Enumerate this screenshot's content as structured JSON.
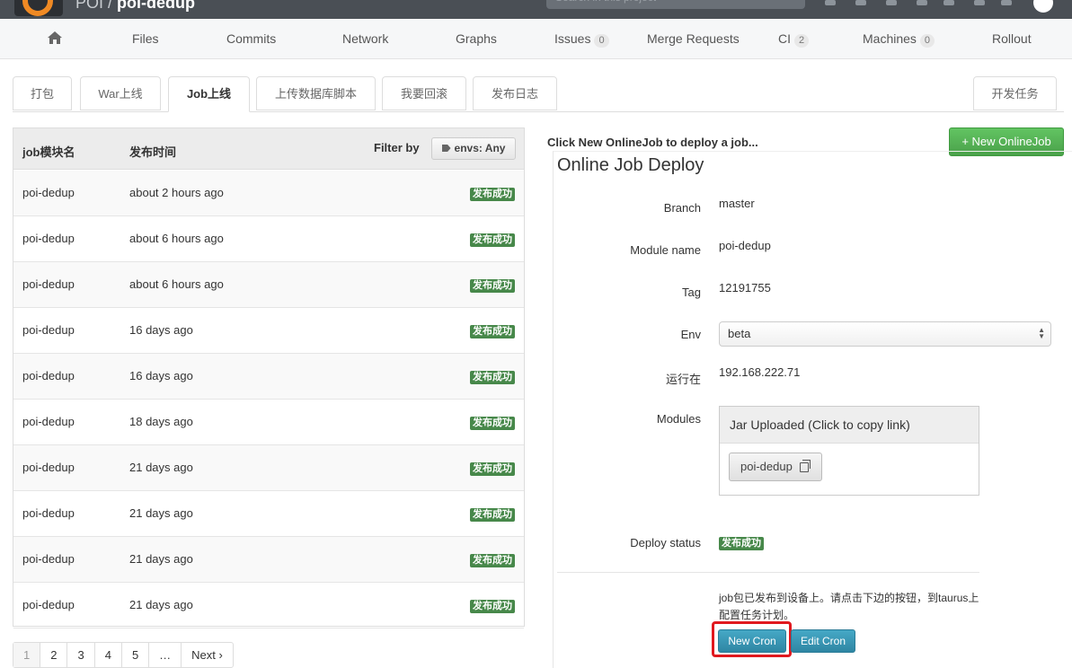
{
  "header": {
    "namespace": "POI / ",
    "project": "poi-dedup",
    "search_placeholder": "Search in this project"
  },
  "nav": {
    "items": [
      {
        "label": "Files"
      },
      {
        "label": "Commits"
      },
      {
        "label": "Network"
      },
      {
        "label": "Graphs"
      },
      {
        "label": "Issues",
        "count": "0"
      },
      {
        "label": "Merge Requests"
      },
      {
        "label": "CI",
        "count": "2"
      },
      {
        "label": "Machines",
        "count": "0"
      },
      {
        "label": "Rollout"
      }
    ]
  },
  "tabs": {
    "items": [
      {
        "label": "打包"
      },
      {
        "label": "War上线"
      },
      {
        "label": "Job上线"
      },
      {
        "label": "上传数据库脚本"
      },
      {
        "label": "我要回滚"
      },
      {
        "label": "发布日志"
      }
    ],
    "active": "Job上线",
    "right": "开发任务"
  },
  "job_table": {
    "col_module": "job模块名",
    "col_time": "发布时间",
    "filter_label": "Filter by",
    "filter_button": "envs: Any",
    "rows": [
      {
        "module": "poi-dedup",
        "time": "about 2 hours ago",
        "status": "发布成功"
      },
      {
        "module": "poi-dedup",
        "time": "about 6 hours ago",
        "status": "发布成功"
      },
      {
        "module": "poi-dedup",
        "time": "about 6 hours ago",
        "status": "发布成功"
      },
      {
        "module": "poi-dedup",
        "time": "16 days ago",
        "status": "发布成功"
      },
      {
        "module": "poi-dedup",
        "time": "16 days ago",
        "status": "发布成功"
      },
      {
        "module": "poi-dedup",
        "time": "18 days ago",
        "status": "发布成功"
      },
      {
        "module": "poi-dedup",
        "time": "21 days ago",
        "status": "发布成功"
      },
      {
        "module": "poi-dedup",
        "time": "21 days ago",
        "status": "发布成功"
      },
      {
        "module": "poi-dedup",
        "time": "21 days ago",
        "status": "发布成功"
      },
      {
        "module": "poi-dedup",
        "time": "21 days ago",
        "status": "发布成功"
      }
    ]
  },
  "pagination": {
    "pages": [
      "1",
      "2",
      "3",
      "4",
      "5",
      "…"
    ],
    "current": "1",
    "next": "Next ›"
  },
  "deploy": {
    "hint": "Click New OnlineJob to deploy a job...",
    "new_button": "+ New OnlineJob",
    "title": "Online Job Deploy",
    "branch_label": "Branch",
    "branch": "master",
    "module_label": "Module name",
    "module": "poi-dedup",
    "tag_label": "Tag",
    "tag": "12191755",
    "env_label": "Env",
    "env": "beta",
    "host_label": "运行在",
    "host": "192.168.222.71",
    "modules_label": "Modules",
    "modules_header": "Jar Uploaded (Click to copy link)",
    "module_button": "poi-dedup",
    "status_label": "Deploy status",
    "status": "发布成功",
    "cron_note": "job包已发布到设备上。请点击下边的按钮，到taurus上配置任务计划。",
    "new_cron": "New Cron",
    "edit_cron": "Edit Cron"
  },
  "colors": {
    "success": "#47884a",
    "primary_green": "#5cb85c",
    "info_blue": "#3a97b5",
    "highlight_red": "#e0191f",
    "topbar": "#4a4f55",
    "brand_orange": "#f08a24"
  }
}
